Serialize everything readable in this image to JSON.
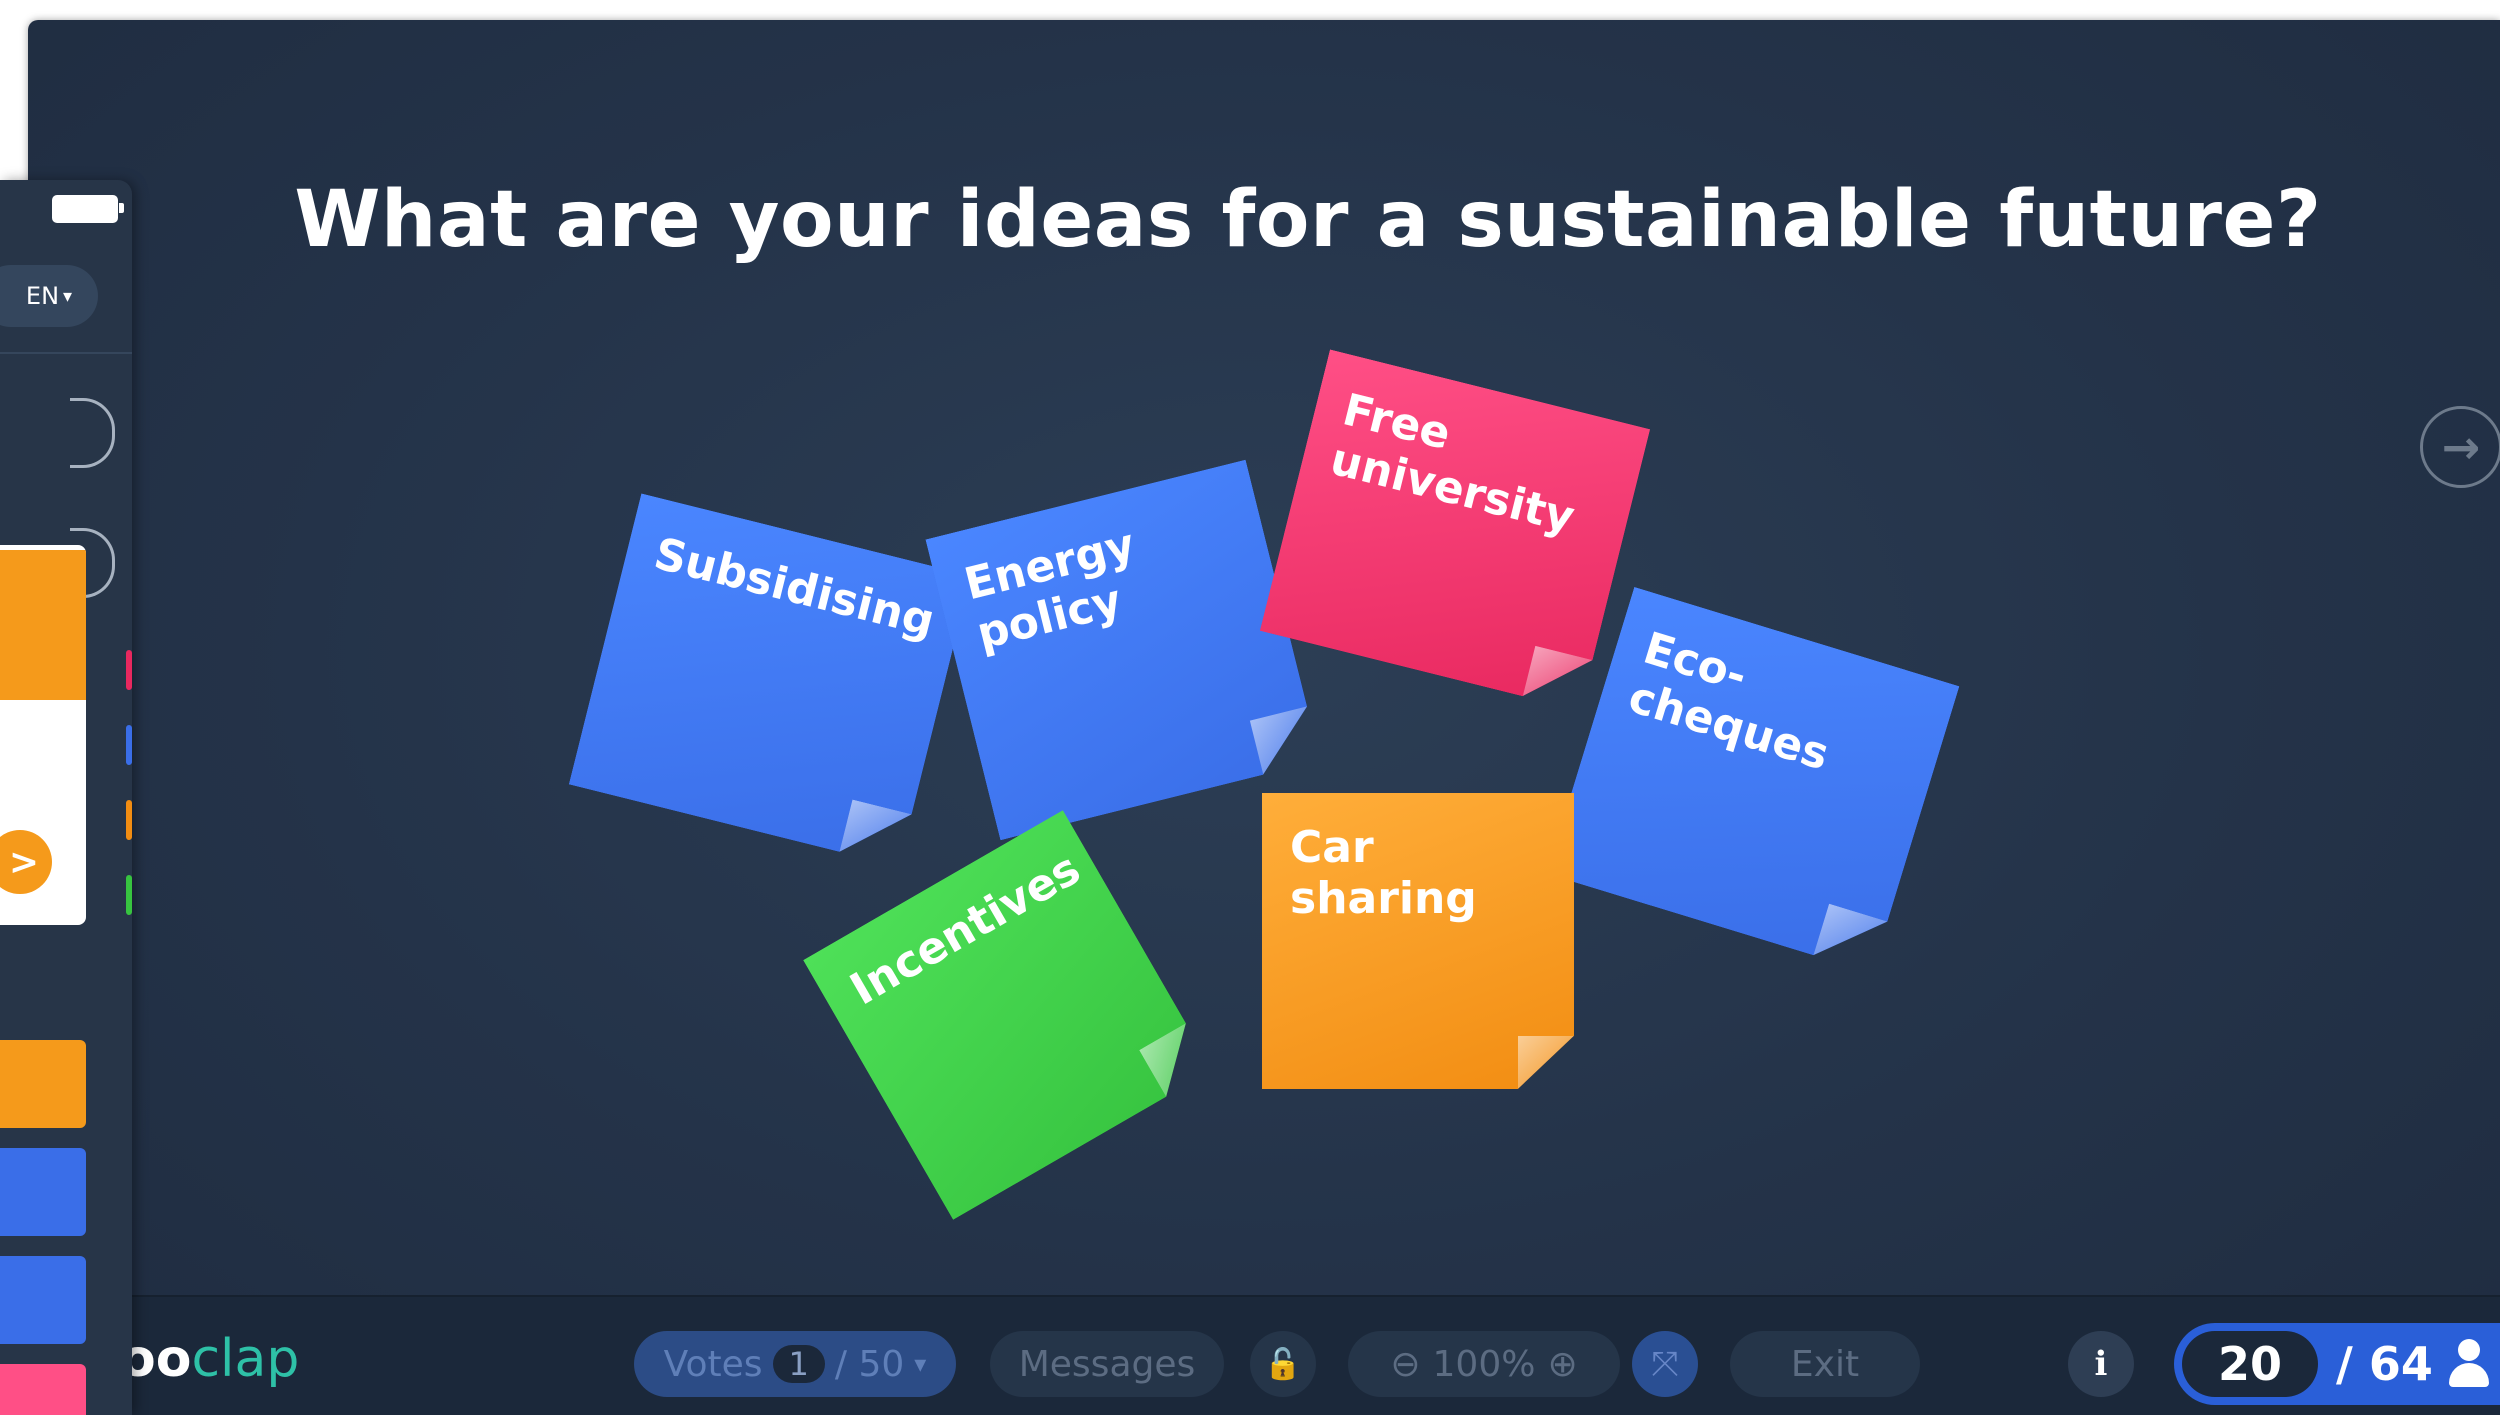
{
  "question": "What are your ideas for a sustainable future?",
  "notes": [
    {
      "text": "Subsidising",
      "color": "#4a86ff"
    },
    {
      "text": "Energy policy",
      "color": "#4a86ff"
    },
    {
      "text": "Free university",
      "color": "#ff4f86"
    },
    {
      "text": "Eco-cheques",
      "color": "#4a86ff"
    },
    {
      "text": "Incentives",
      "color": "#4ee058"
    },
    {
      "text": "Car sharing",
      "color": "#ffae3a"
    }
  ],
  "toolbar": {
    "brand_prefix": "oo",
    "brand_suffix": "clap",
    "votes_label": "Votes",
    "votes_current": "1",
    "votes_total": "/ 50",
    "messages_label": "Messages",
    "zoom_level": "100%",
    "exit_label": "Exit",
    "info_label": "i",
    "participants_current": "20",
    "participants_total": "/ 64"
  },
  "phone": {
    "language": "EN"
  },
  "icons": {
    "next": "arrow-right-icon",
    "lock": "unlock-icon",
    "zoom_out": "zoom-out-icon",
    "zoom_in": "zoom-in-icon",
    "fullscreen": "fullscreen-icon",
    "user": "user-icon"
  },
  "colors": {
    "background": "#243349",
    "toolbar": "#1b283a",
    "brand_accent": "#2ec1a7",
    "participants": "#2a5fd8"
  }
}
